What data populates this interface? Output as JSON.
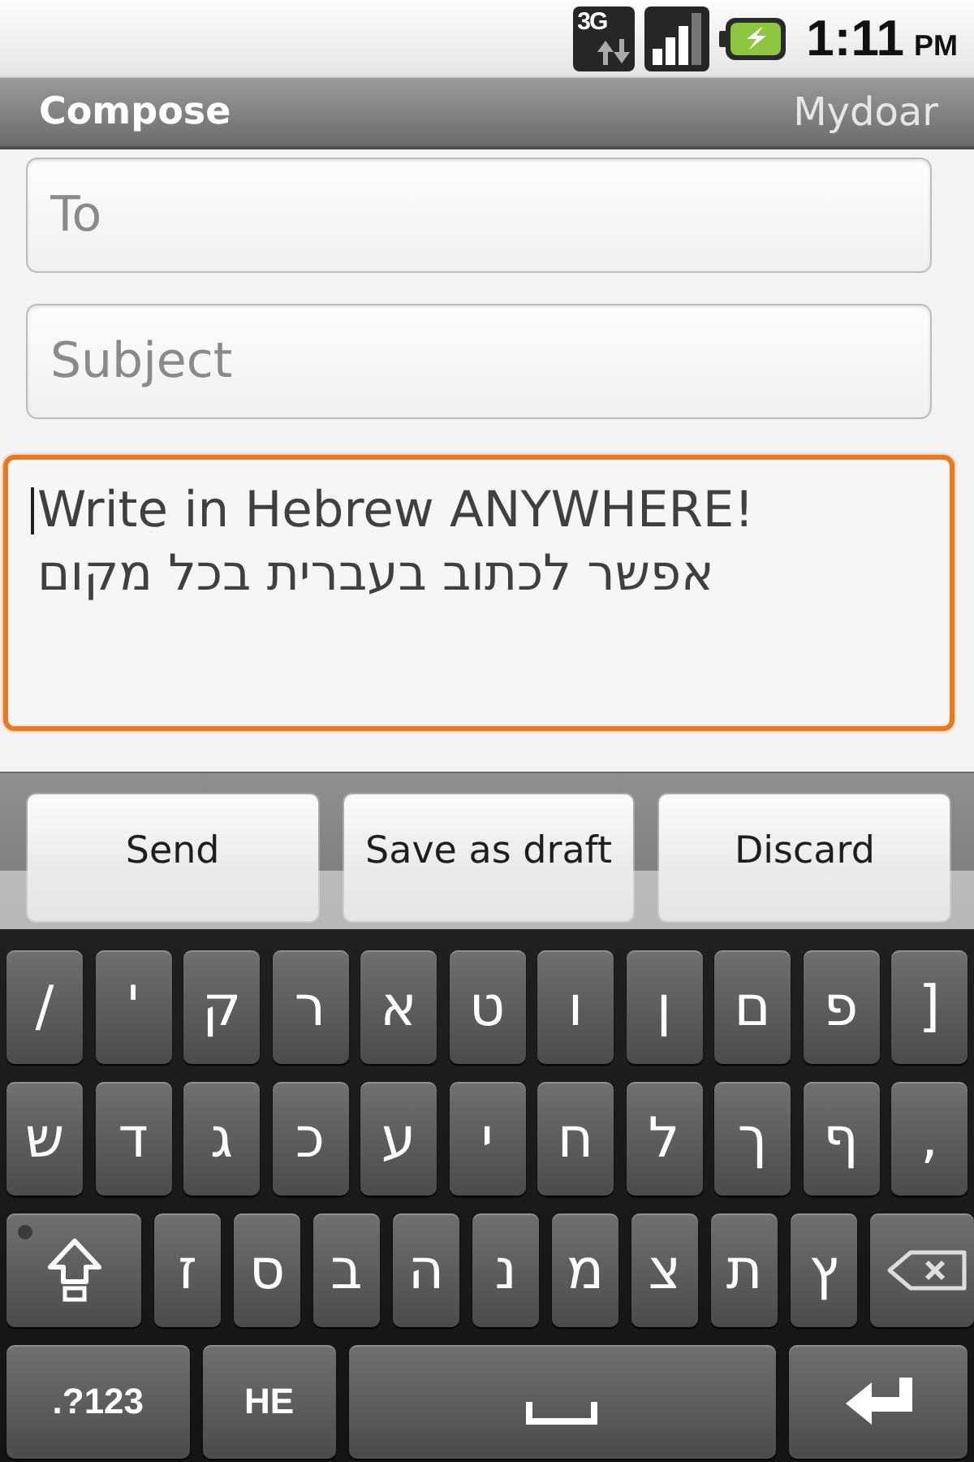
{
  "status_bar": {
    "network": "3G",
    "time": "1:11",
    "period": "PM"
  },
  "title_bar": {
    "title": "Compose",
    "account": "Mydoar"
  },
  "fields": [
    {
      "placeholder": "To"
    },
    {
      "placeholder": "Subject"
    }
  ],
  "body": {
    "focused": true,
    "value_lines": [
      "Write in Hebrew ANYWHERE!",
      "אפשר לכתוב בעברית בכל מקום"
    ]
  },
  "buttons": [
    "Send",
    "Save as draft",
    "Discard"
  ],
  "keyboard": {
    "rows": [
      [
        {
          "kind": "char",
          "label": "/"
        },
        {
          "kind": "char",
          "label": "'"
        },
        {
          "kind": "char",
          "label": "ק"
        },
        {
          "kind": "char",
          "label": "ר"
        },
        {
          "kind": "char",
          "label": "א"
        },
        {
          "kind": "char",
          "label": "ט"
        },
        {
          "kind": "char",
          "label": "ו"
        },
        {
          "kind": "char",
          "label": "ן"
        },
        {
          "kind": "char",
          "label": "ם"
        },
        {
          "kind": "char",
          "label": "פ"
        },
        {
          "kind": "char",
          "label": "]"
        }
      ],
      [
        {
          "kind": "char",
          "label": "ש"
        },
        {
          "kind": "char",
          "label": "ד"
        },
        {
          "kind": "char",
          "label": "ג"
        },
        {
          "kind": "char",
          "label": "כ"
        },
        {
          "kind": "char",
          "label": "ע"
        },
        {
          "kind": "char",
          "label": "י"
        },
        {
          "kind": "char",
          "label": "ח"
        },
        {
          "kind": "char",
          "label": "ל"
        },
        {
          "kind": "char",
          "label": "ך"
        },
        {
          "kind": "char",
          "label": "ף"
        },
        {
          "kind": "char",
          "label": ","
        }
      ],
      [
        {
          "kind": "shift",
          "locked": false
        },
        {
          "kind": "char",
          "label": "ז"
        },
        {
          "kind": "char",
          "label": "ס"
        },
        {
          "kind": "char",
          "label": "ב"
        },
        {
          "kind": "char",
          "label": "ה"
        },
        {
          "kind": "char",
          "label": "נ"
        },
        {
          "kind": "char",
          "label": "מ"
        },
        {
          "kind": "char",
          "label": "צ"
        },
        {
          "kind": "char",
          "label": "ת"
        },
        {
          "kind": "char",
          "label": "ץ"
        },
        {
          "kind": "backspace"
        }
      ],
      [
        {
          "kind": "symbols",
          "label": ".?123"
        },
        {
          "kind": "language",
          "label": "HE"
        },
        {
          "kind": "space"
        },
        {
          "kind": "enter"
        }
      ]
    ]
  }
}
